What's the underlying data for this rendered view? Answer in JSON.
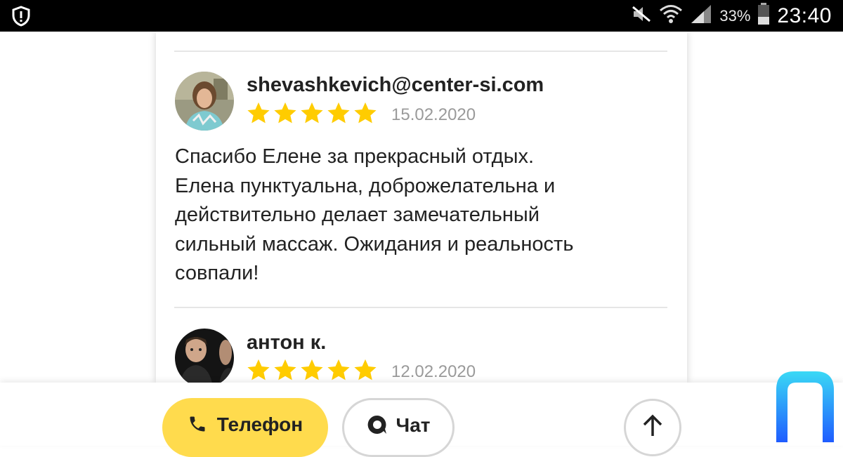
{
  "status_bar": {
    "battery_percent": "33%",
    "time": "23:40",
    "icons": [
      "shield-alert-icon",
      "mute-icon",
      "wifi-icon",
      "signal-icon",
      "battery-icon"
    ]
  },
  "reviews": [
    {
      "author": "shevashkevich@center-si.com",
      "rating": 5,
      "date": "15.02.2020",
      "text_lines": [
        "Спасибо Елене за прекрасный отдых.",
        "Елена пунктуальна, доброжелательна и",
        "действительно делает замечательный",
        "сильный массаж. Ожидания и реальность",
        "совпали!"
      ]
    },
    {
      "author": "антон к.",
      "rating": 5,
      "date": "12.02.2020"
    }
  ],
  "bottom_bar": {
    "phone_label": "Телефон",
    "chat_label": "Чат"
  },
  "colors": {
    "star": "#ffcc00",
    "phone_button": "#ffdb4d",
    "accent_logo": "#2e8cff"
  }
}
